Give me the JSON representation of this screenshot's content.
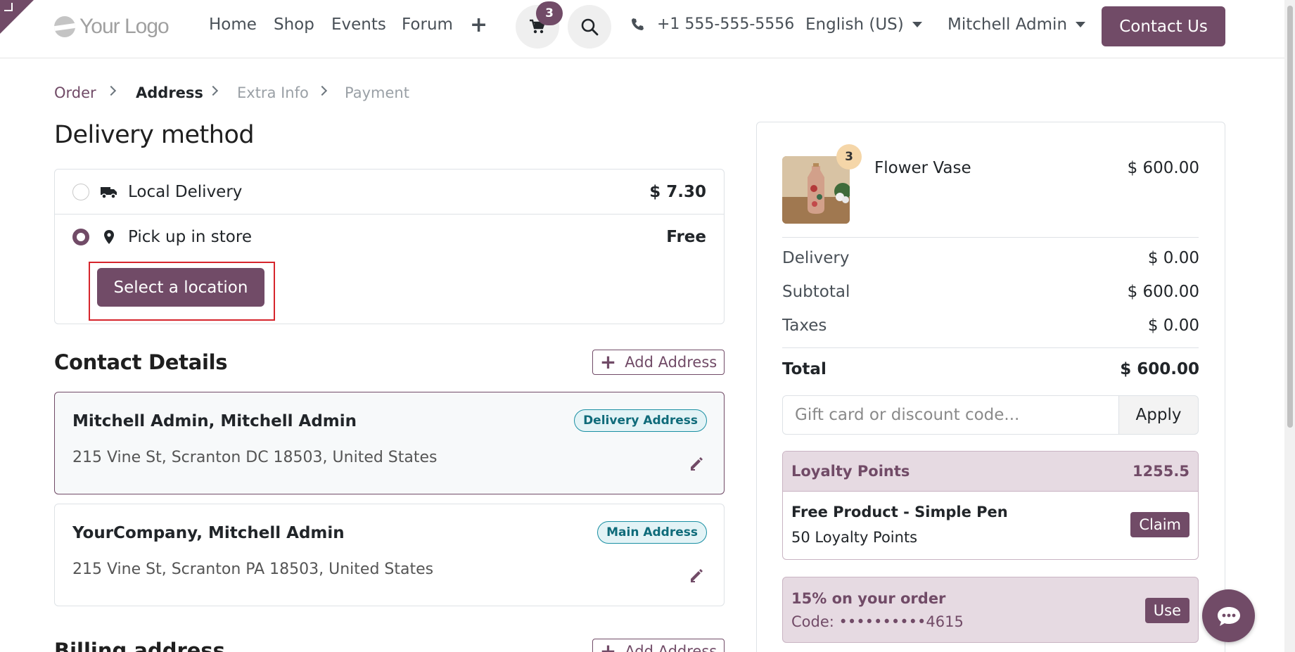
{
  "header": {
    "logo_text": "Your Logo",
    "nav": [
      "Home",
      "Shop",
      "Events",
      "Forum"
    ],
    "cart_count": "3",
    "phone": "+1 555-555-5556",
    "language": "English (US)",
    "user": "Mitchell Admin",
    "contact_label": "Contact Us"
  },
  "breadcrumb": {
    "order": "Order",
    "address": "Address",
    "extra_info": "Extra Info",
    "payment": "Payment"
  },
  "delivery": {
    "title": "Delivery method",
    "methods": [
      {
        "label": "Local Delivery",
        "price": "$ 7.30",
        "selected": false
      },
      {
        "label": "Pick up in store",
        "price": "Free",
        "selected": true
      }
    ],
    "select_location_label": "Select a location"
  },
  "contact": {
    "title": "Contact Details",
    "add_address_label": "Add Address",
    "addresses": [
      {
        "name": "Mitchell Admin, Mitchell Admin",
        "line": "215 Vine St, Scranton DC 18503, United States",
        "badge": "Delivery Address"
      },
      {
        "name": "YourCompany, Mitchell Admin",
        "line": "215 Vine St, Scranton PA 18503, United States",
        "badge": "Main Address"
      }
    ]
  },
  "billing": {
    "title": "Billing address",
    "add_address_label": "Add Address"
  },
  "summary": {
    "product": {
      "name": "Flower Vase",
      "qty": "3",
      "price": "$ 600.00"
    },
    "delivery_label": "Delivery",
    "delivery_value": "$ 0.00",
    "subtotal_label": "Subtotal",
    "subtotal_value": "$ 600.00",
    "taxes_label": "Taxes",
    "taxes_value": "$ 0.00",
    "total_label": "Total",
    "total_value": "$ 600.00",
    "gift_placeholder": "Gift card or discount code...",
    "apply_label": "Apply"
  },
  "loyalty": {
    "title": "Loyalty Points",
    "points": "1255.5",
    "reward_name": "Free Product - Simple Pen",
    "reward_cost": "50 Loyalty Points",
    "claim_label": "Claim"
  },
  "promo": {
    "title": "15% on your order",
    "code": "Code: ••••••••••4615",
    "use_label": "Use"
  },
  "colors": {
    "brand": "#714b67",
    "badge_teal": "#1a8fa3",
    "highlight_red": "#d6252c"
  }
}
